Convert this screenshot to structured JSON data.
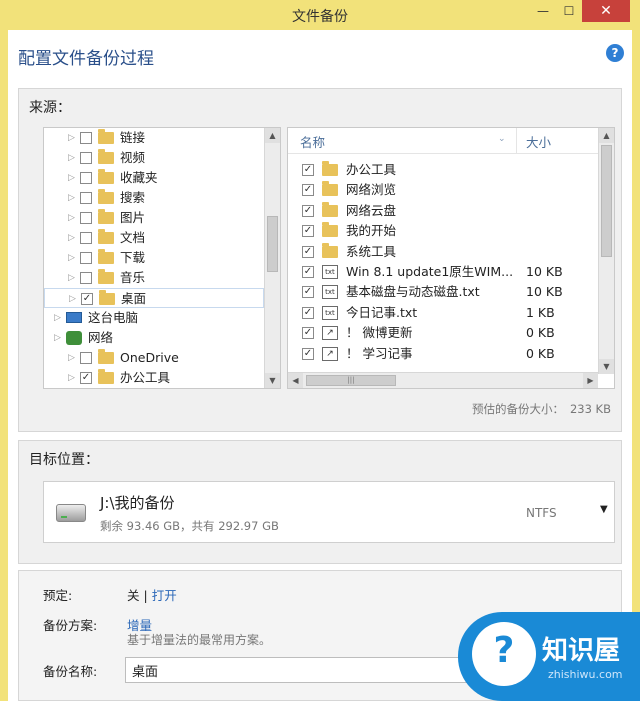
{
  "window": {
    "title": "文件备份",
    "minimize_glyph": "—",
    "maximize_glyph": "☐",
    "close_glyph": "✕"
  },
  "header": {
    "title": "配置文件备份过程",
    "help_glyph": "?"
  },
  "source": {
    "label": "来源：",
    "tree": [
      {
        "label": "链接",
        "checked": false,
        "icon": "folder-icon"
      },
      {
        "label": "视频",
        "checked": false,
        "icon": "folder-icon"
      },
      {
        "label": "收藏夹",
        "checked": false,
        "icon": "folder-icon"
      },
      {
        "label": "搜索",
        "checked": false,
        "icon": "folder-icon"
      },
      {
        "label": "图片",
        "checked": false,
        "icon": "folder-icon"
      },
      {
        "label": "文档",
        "checked": false,
        "icon": "folder-icon"
      },
      {
        "label": "下载",
        "checked": false,
        "icon": "folder-icon"
      },
      {
        "label": "音乐",
        "checked": false,
        "icon": "folder-icon"
      },
      {
        "label": "桌面",
        "checked": true,
        "icon": "folder-icon"
      },
      {
        "label": "这台电脑",
        "icon": "computer-icon"
      },
      {
        "label": "网络",
        "icon": "network-icon"
      },
      {
        "label": "OneDrive",
        "checked": false,
        "icon": "folder-icon"
      },
      {
        "label": "办公工具",
        "checked": true,
        "icon": "folder-icon"
      }
    ],
    "list": {
      "col_name": "名称",
      "col_size": "大小",
      "sort_glyph": "⌄",
      "rows": [
        {
          "name": "办公工具",
          "size": "",
          "type": "folder"
        },
        {
          "name": "网络浏览",
          "size": "",
          "type": "folder"
        },
        {
          "name": "网络云盘",
          "size": "",
          "type": "folder"
        },
        {
          "name": "我的开始",
          "size": "",
          "type": "folder"
        },
        {
          "name": "系统工具",
          "size": "",
          "type": "folder"
        },
        {
          "name": "Win 8.1 update1原生WIM...",
          "size": "10 KB",
          "type": "txt"
        },
        {
          "name": "基本磁盘与动态磁盘.txt",
          "size": "10 KB",
          "type": "txt"
        },
        {
          "name": "今日记事.txt",
          "size": "1 KB",
          "type": "txt"
        },
        {
          "name": "！ 微博更新",
          "size": "0 KB",
          "type": "shortcut"
        },
        {
          "name": "！ 学习记事",
          "size": "0 KB",
          "type": "shortcut"
        }
      ],
      "txt_icon_label": "txt"
    },
    "estimate_label": "预估的备份大小：",
    "estimate_value": "233 KB"
  },
  "target": {
    "label": "目标位置：",
    "path": "J:\\我的备份",
    "free": "剩余 93.46 GB，共有 292.97 GB",
    "fs": "NTFS",
    "dropdown_glyph": "▼"
  },
  "options": {
    "schedule_label": "预定:",
    "schedule_off": "关",
    "schedule_sep": "|",
    "schedule_on": "打开",
    "scheme_label": "备份方案:",
    "scheme_value": "增量",
    "scheme_desc": "基于增量法的最常用方案。",
    "name_label": "备份名称:",
    "name_value": "桌面"
  },
  "watermark": {
    "brand": "知识屋",
    "site": "zhishiwu.com",
    "logo_glyph": "?"
  },
  "colors": {
    "titlebar": "#f2e27a",
    "close": "#c7413b",
    "accent": "#2a67b8",
    "watermark": "#1a8ad6"
  }
}
